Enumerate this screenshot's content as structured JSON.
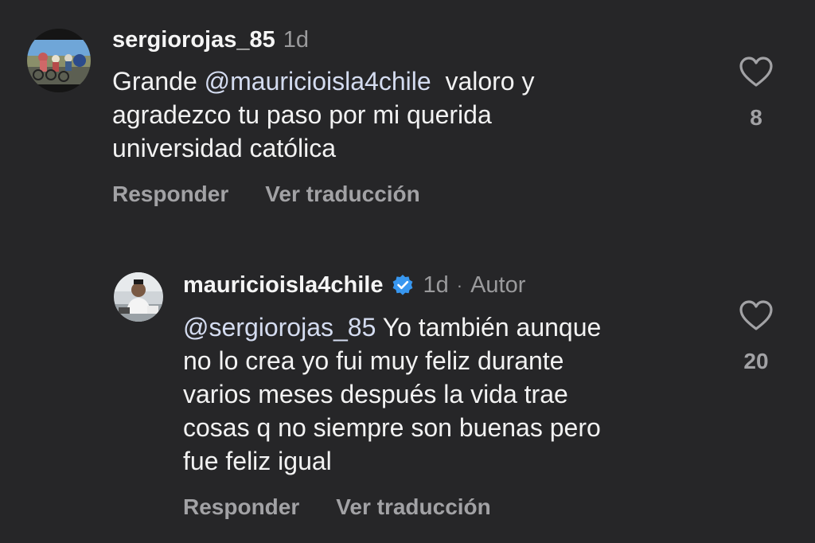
{
  "comment": {
    "username": "sergiorojas_85",
    "time": "1d",
    "text_prefix": "Grande ",
    "mention": "@mauricioisla4chile",
    "text_line1_rest": "  valoro y",
    "text_line2": "agradezco tu paso por mi querida",
    "text_line3": "universidad católica",
    "likes": "8",
    "reply_label": "Responder",
    "translate_label": "Ver traducción",
    "avatar_icon": "cyclists-photo-avatar"
  },
  "reply": {
    "username": "mauricioisla4chile",
    "time": "1d",
    "dot": "·",
    "author_label": "Autor",
    "mention": "@sergiorojas_85",
    "text_line1_rest": " Yo también aunque",
    "text_line2": "no lo crea yo fui muy feliz durante",
    "text_line3": "varios meses después la vida trae",
    "text_line4": "cosas q no siempre son buenas pero",
    "text_line5": "fue feliz igual",
    "likes": "20",
    "reply_label": "Responder",
    "translate_label": "Ver traducción",
    "verified_color": "#3897f0",
    "avatar_icon": "man-photo-avatar"
  }
}
